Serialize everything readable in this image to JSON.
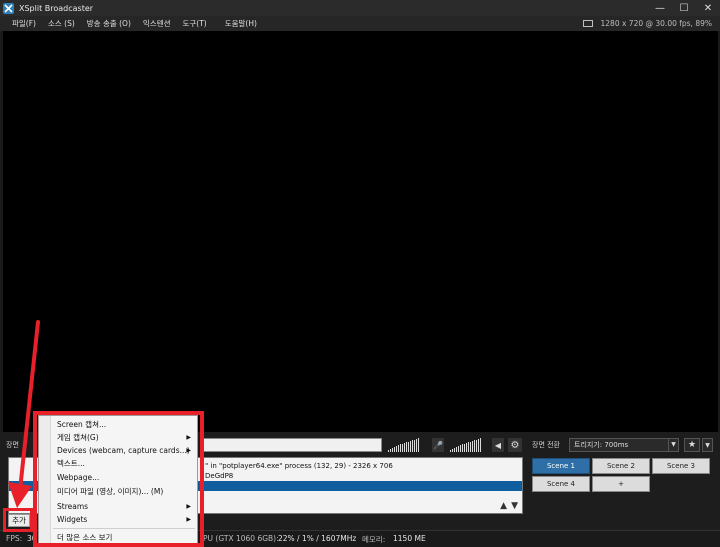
{
  "window": {
    "title": "XSplit Broadcaster"
  },
  "menu": [
    "파일(F)",
    "소스 (S)",
    "방송 송출 (O)",
    "익스텐션",
    "도구(T)",
    "도움말(H)"
  ],
  "resolution_info": "1280 x 720 @ 30.00 fps, 89%",
  "labels": {
    "scene_left": "장면",
    "scene_transition": "장면 전환"
  },
  "transition": {
    "value": "트리지기: 700ms"
  },
  "source_list": {
    "row1": "\" in \"potplayer64.exe\" process (132, 29) - 2326 x 706",
    "row2": "DeGdP8",
    "row3": ""
  },
  "add_button": "추가",
  "scenes": [
    "Scene 1",
    "Scene 2",
    "Scene 3",
    "Scene 4",
    "+"
  ],
  "status": {
    "fps_label": "FPS:",
    "fps_value": "30",
    "gpu_label": "PU (GTX 1060 6GB):",
    "gpu_value": "22% / 1% / 1607MHz",
    "mem_label": "메모리:",
    "mem_value": "1150 ME"
  },
  "context_menu": {
    "items": [
      {
        "label": "Screen 캡쳐...",
        "submenu": false
      },
      {
        "label": "게임 캡쳐(G)",
        "submenu": true
      },
      {
        "label": "Devices (webcam, capture cards...)",
        "submenu": true
      },
      {
        "label": "텍스트...",
        "submenu": false
      },
      {
        "label": "Webpage...",
        "submenu": false
      },
      {
        "label": "미디어 파일 (영상, 이미지)... (M)",
        "submenu": false
      },
      {
        "label": "Streams",
        "submenu": true
      },
      {
        "label": "Widgets",
        "submenu": true
      },
      {
        "label": "더 많은 소스 보기",
        "submenu": false
      }
    ]
  },
  "colors": {
    "highlight": "#e8202a",
    "accent": "#2d6fa6"
  }
}
